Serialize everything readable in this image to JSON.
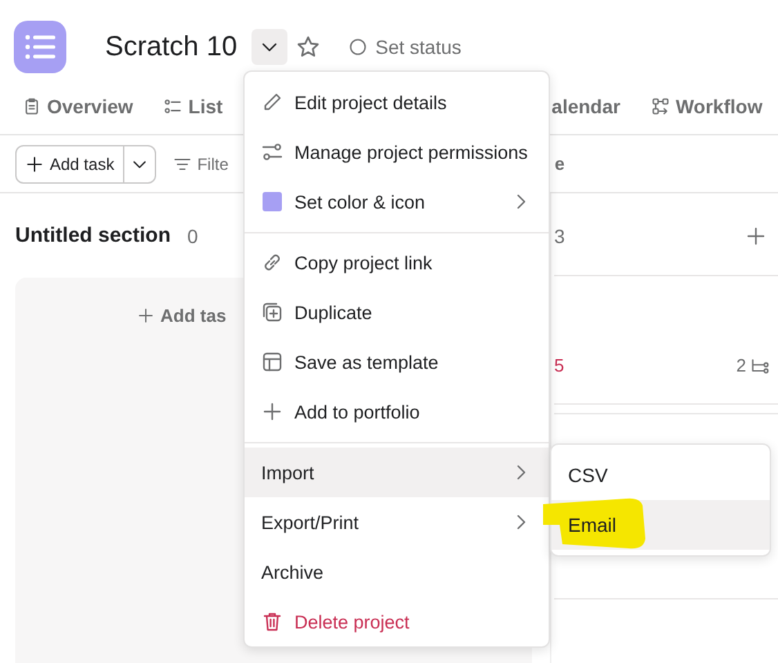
{
  "project": {
    "title": "Scratch 10",
    "status": "Set status"
  },
  "tabs": [
    {
      "label": "Overview",
      "selected": false
    },
    {
      "label": "List",
      "selected": false
    },
    {
      "label": "alendar",
      "selected": false
    },
    {
      "label": "Workflow",
      "selected": false
    }
  ],
  "toolbar": {
    "add_task": "Add task",
    "filter": "Filte",
    "column_3": "e"
  },
  "board": {
    "sections": [
      {
        "title": "Untitled section",
        "count": "0",
        "add_task": "Add tas"
      },
      {
        "count": "3",
        "cards": [
          {
            "kind": "task",
            "column_1": "5",
            "subtasks": "2"
          },
          {
            "kind": "blank"
          }
        ]
      }
    ]
  },
  "menu": {
    "groups": [
      [
        {
          "label": "Edit project details",
          "kind": "item",
          "has_submenu": false,
          "selected": false
        },
        {
          "label": "Manage project permissions",
          "kind": "item",
          "has_submenu": false,
          "selected": false
        },
        {
          "label": "Set color & icon",
          "kind": "item",
          "has_submenu": true,
          "selected": false
        }
      ],
      [
        {
          "label": "Copy project link",
          "kind": "item",
          "has_submenu": false,
          "selected": false
        },
        {
          "label": "Duplicate",
          "kind": "item",
          "has_submenu": false,
          "selected": false
        },
        {
          "label": "Save as template",
          "kind": "item",
          "has_submenu": false,
          "selected": false
        },
        {
          "label": "Add to portfolio",
          "kind": "item",
          "has_submenu": false,
          "selected": false
        }
      ],
      [
        {
          "label": "Import",
          "kind": "item",
          "has_submenu": true,
          "selected": true
        },
        {
          "label": "Export/Print",
          "kind": "item",
          "has_submenu": true,
          "selected": false
        },
        {
          "label": "Archive",
          "kind": "item",
          "has_submenu": false,
          "selected": false
        },
        {
          "label": "Delete project",
          "kind": "danger",
          "has_submenu": false,
          "selected": false
        }
      ]
    ]
  },
  "submenu": {
    "items": [
      {
        "label": "CSV",
        "selected": false,
        "highlighted": false
      },
      {
        "label": "Email",
        "selected": true,
        "highlighted": true
      }
    ]
  }
}
